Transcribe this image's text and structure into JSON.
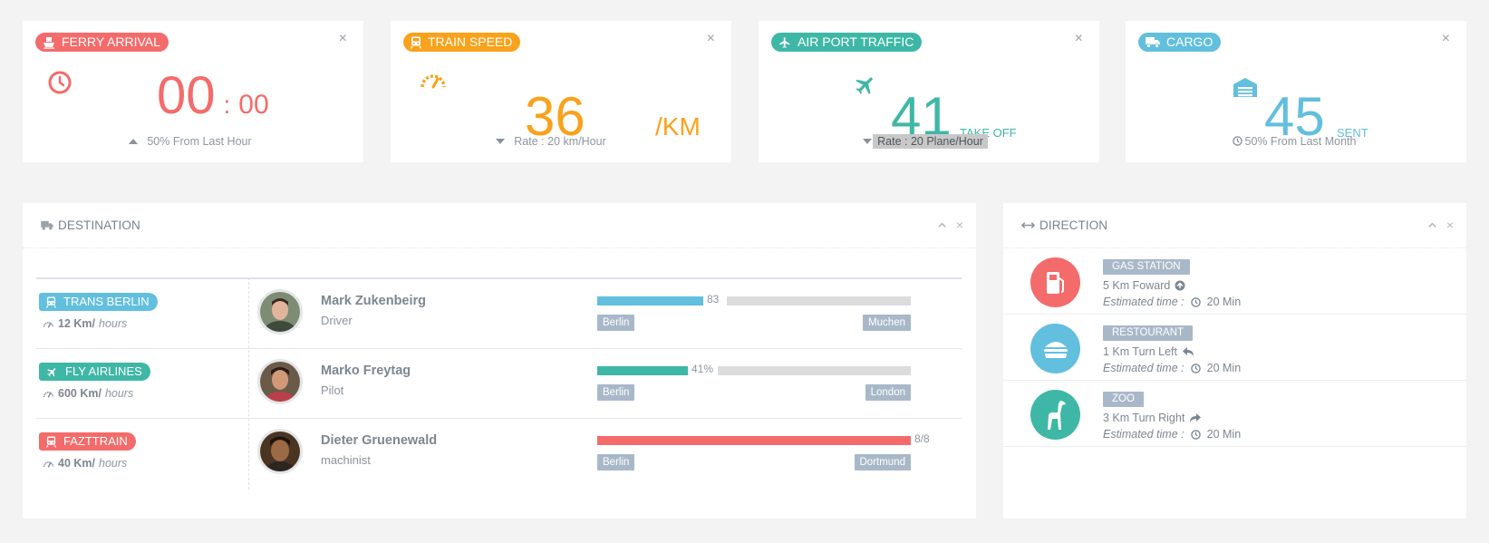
{
  "stats": {
    "ferry": {
      "label": "FERRY ARRIVAL",
      "hours": "00",
      "sep": ":",
      "minutes": "00",
      "footer": "50%  From Last Hour",
      "color": "#f46b6b",
      "icon": "ship-icon"
    },
    "train": {
      "label": "TRAIN SPEED",
      "value": "36",
      "unit": "/KM",
      "footer": "Rate : 20 km/Hour",
      "color": "#f9a21b",
      "icon": "train-icon"
    },
    "air": {
      "label": "AIR PORT TRAFFIC",
      "value": "41",
      "unit": "TAKE OFF",
      "footer": "Rate : 20 Plane/Hour",
      "color": "#3fb7a6",
      "icon": "plane-icon"
    },
    "cargo": {
      "label": "CARGO",
      "value": "45",
      "unit": "SENT",
      "footer": "50% From Last Month",
      "color": "#62bfdd",
      "icon": "truck-icon"
    }
  },
  "destination": {
    "title": "DESTINATION",
    "rows": [
      {
        "label": "TRANS BERLIN",
        "color": "#62bfdd",
        "speed": "12 Km/",
        "speed_unit": "hours",
        "name": "Mark Zukenbeirg",
        "role": "Driver",
        "progress_label": "83",
        "progress": 0.46,
        "bar_color": "#62bfdd",
        "from": "Berlin",
        "to": "Muchen"
      },
      {
        "label": "FLY AIRLINES",
        "color": "#3fb7a6",
        "speed": "600 Km/",
        "speed_unit": "hours",
        "name": "Marko Freytag",
        "role": "Pilot",
        "progress_label": "41%",
        "progress": 0.41,
        "bar_color": "#3fb7a6",
        "from": "Berlin",
        "to": "London"
      },
      {
        "label": "FAZTTRAIN",
        "color": "#f46b6b",
        "speed": "40 Km/",
        "speed_unit": "hours",
        "name": "Dieter Gruenewald",
        "role": "machinist",
        "progress_label": "8/8",
        "progress": 1.0,
        "bar_color": "#f46b6b",
        "from": "Berlin",
        "to": "Dortmund"
      }
    ]
  },
  "direction": {
    "title": "DIRECTION",
    "eta_label": "Estimated time :",
    "items": [
      {
        "tag": "GAS STATION",
        "desc": "5 Km Foward",
        "eta": "20 Min",
        "color": "#f46b6b",
        "icon": "gas-pump-icon"
      },
      {
        "tag": "RESTOURANT",
        "desc": "1 Km Turn Left",
        "eta": "20 Min",
        "color": "#62bfdd",
        "icon": "burger-icon"
      },
      {
        "tag": "ZOO",
        "desc": "3 Km Turn Right",
        "eta": "20 Min",
        "color": "#3fb7a6",
        "icon": "giraffe-icon"
      }
    ]
  },
  "close_symbol": "×"
}
